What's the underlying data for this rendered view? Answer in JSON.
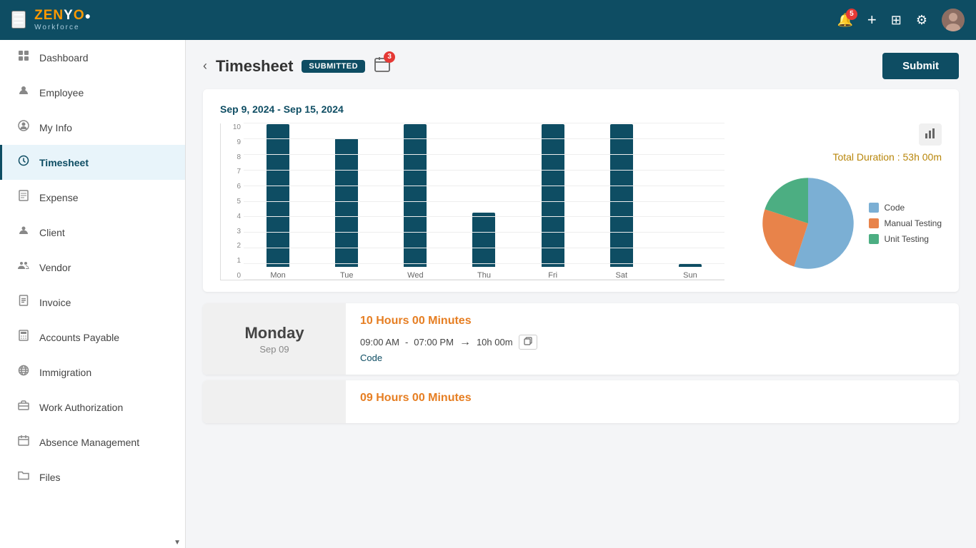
{
  "app": {
    "name": "ZENYO",
    "subtitle": "Workforce"
  },
  "topnav": {
    "notification_count": "5",
    "calendar_badge": "3",
    "hamburger_label": "☰",
    "add_label": "+",
    "grid_label": "⊞",
    "settings_label": "⚙"
  },
  "sidebar": {
    "items": [
      {
        "id": "dashboard",
        "label": "Dashboard",
        "icon": "grid"
      },
      {
        "id": "employee",
        "label": "Employee",
        "icon": "person"
      },
      {
        "id": "myinfo",
        "label": "My Info",
        "icon": "person-circle"
      },
      {
        "id": "timesheet",
        "label": "Timesheet",
        "icon": "clock",
        "active": true
      },
      {
        "id": "expense",
        "label": "Expense",
        "icon": "receipt"
      },
      {
        "id": "client",
        "label": "Client",
        "icon": "person-badge"
      },
      {
        "id": "vendor",
        "label": "Vendor",
        "icon": "people"
      },
      {
        "id": "invoice",
        "label": "Invoice",
        "icon": "file-text"
      },
      {
        "id": "accounts-payable",
        "label": "Accounts Payable",
        "icon": "calculator"
      },
      {
        "id": "immigration",
        "label": "Immigration",
        "icon": "globe"
      },
      {
        "id": "work-authorization",
        "label": "Work Authorization",
        "icon": "briefcase"
      },
      {
        "id": "absence-management",
        "label": "Absence Management",
        "icon": "calendar-x"
      },
      {
        "id": "files",
        "label": "Files",
        "icon": "folder"
      }
    ]
  },
  "page": {
    "title": "Timesheet",
    "status_badge": "SUBMITTED",
    "submit_button": "Submit",
    "back_label": "‹"
  },
  "chart": {
    "date_range": "Sep 9, 2024 - Sep 15, 2024",
    "total_duration_label": "Total Duration : 53h 00m",
    "bars": [
      {
        "day": "Mon",
        "value": 10,
        "height_pct": 100
      },
      {
        "day": "Tue",
        "value": 9,
        "height_pct": 90
      },
      {
        "day": "Wed",
        "value": 10,
        "height_pct": 100
      },
      {
        "day": "Thu",
        "value": 3.8,
        "height_pct": 38
      },
      {
        "day": "Fri",
        "value": 10,
        "height_pct": 100
      },
      {
        "day": "Sat",
        "value": 10,
        "height_pct": 100
      },
      {
        "day": "Sun",
        "value": 0.2,
        "height_pct": 2
      }
    ],
    "y_labels": [
      "0",
      "1",
      "2",
      "3",
      "4",
      "5",
      "6",
      "7",
      "8",
      "9",
      "10"
    ],
    "pie": {
      "segments": [
        {
          "label": "Code",
          "color": "#7bafd4",
          "pct": 55
        },
        {
          "label": "Manual Testing",
          "color": "#e8834a",
          "pct": 25
        },
        {
          "label": "Unit Testing",
          "color": "#4cae82",
          "pct": 20
        }
      ]
    }
  },
  "entries": [
    {
      "day": "Monday",
      "date": "Sep 09",
      "hours": "10 Hours 00 Minutes",
      "time_start": "09:00 AM",
      "time_end": "07:00 PM",
      "duration": "10h 00m",
      "category": "Code"
    },
    {
      "day": "",
      "date": "",
      "hours": "09 Hours 00 Minutes",
      "time_start": "",
      "time_end": "",
      "duration": "",
      "category": ""
    }
  ]
}
